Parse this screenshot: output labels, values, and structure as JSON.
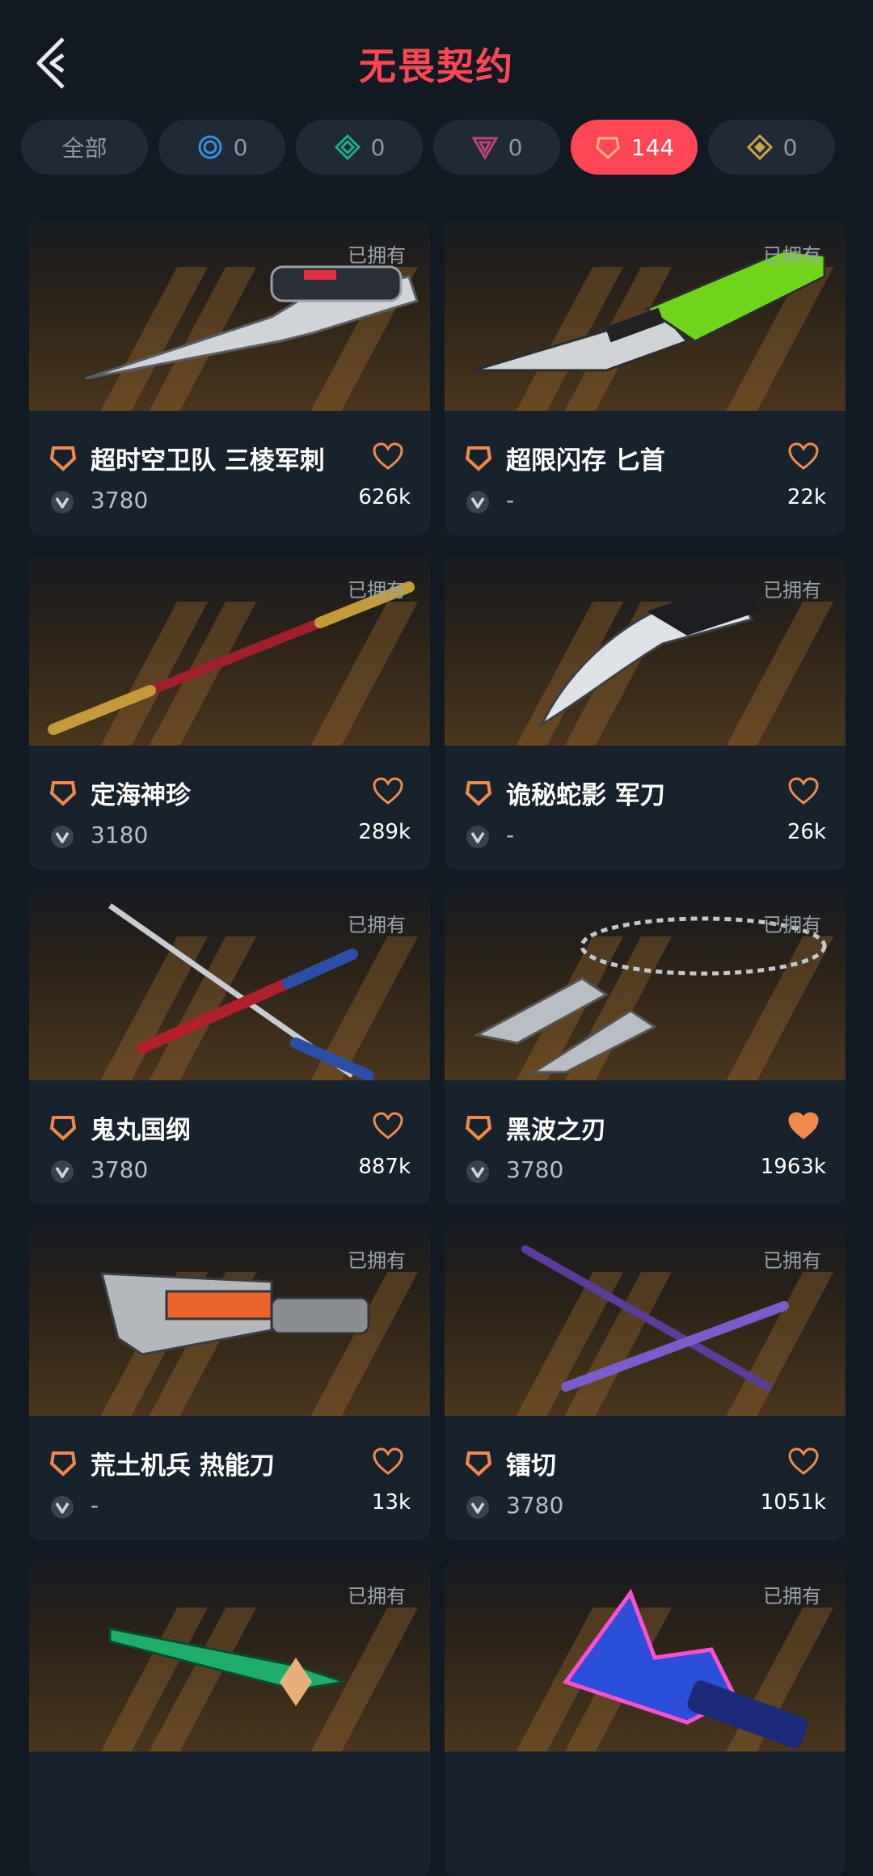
{
  "header": {
    "title": "无畏契约"
  },
  "tabs": [
    {
      "label": "全部",
      "count": ""
    },
    {
      "label": "",
      "count": "0"
    },
    {
      "label": "",
      "count": "0"
    },
    {
      "label": "",
      "count": "0"
    },
    {
      "label": "",
      "count": "144"
    },
    {
      "label": "",
      "count": "0"
    }
  ],
  "colors": {
    "accent": "#ff4655",
    "tier": "#f08a4b",
    "background": "#111a23"
  },
  "cards": [
    {
      "owned": "已拥有",
      "name": "超时空卫队 三棱军刺",
      "price": "3780",
      "likes": "626k",
      "liked": false
    },
    {
      "owned": "已拥有",
      "name": "超限闪存 匕首",
      "price": "-",
      "likes": "22k",
      "liked": false
    },
    {
      "owned": "已拥有",
      "name": "定海神珍",
      "price": "3180",
      "likes": "289k",
      "liked": false
    },
    {
      "owned": "已拥有",
      "name": "诡秘蛇影 军刀",
      "price": "-",
      "likes": "26k",
      "liked": false
    },
    {
      "owned": "已拥有",
      "name": "鬼丸国纲",
      "price": "3780",
      "likes": "887k",
      "liked": false
    },
    {
      "owned": "已拥有",
      "name": "黑波之刃",
      "price": "3780",
      "likes": "1963k",
      "liked": true
    },
    {
      "owned": "已拥有",
      "name": "荒土机兵 热能刀",
      "price": "-",
      "likes": "13k",
      "liked": false
    },
    {
      "owned": "已拥有",
      "name": "镭切",
      "price": "3780",
      "likes": "1051k",
      "liked": false
    },
    {
      "owned": "已拥有"
    },
    {
      "owned": "已拥有"
    }
  ]
}
